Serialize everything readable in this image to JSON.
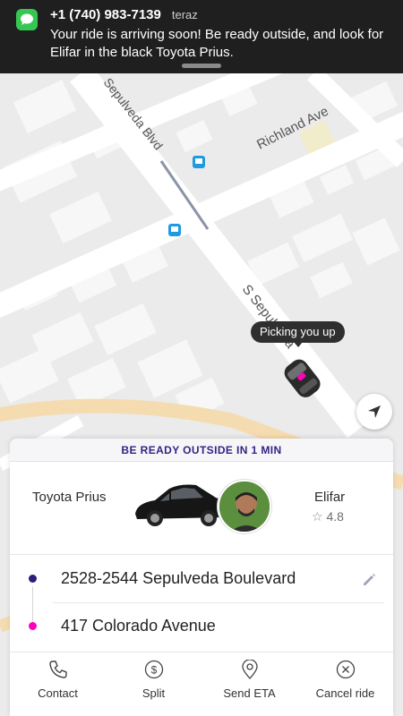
{
  "notification": {
    "sender": "+1 (740) 983-7139",
    "time": "teraz",
    "body": "Your ride is arriving soon! Be ready outside, and look for Elifar in the black Toyota Prius.",
    "icon": "messages-icon"
  },
  "map": {
    "streets": [
      {
        "label": "Sepulveda Blvd"
      },
      {
        "label": "Richland Ave"
      },
      {
        "label": "S Sepulveda"
      }
    ],
    "bubble": "Picking you up",
    "locate_icon": "navigation-arrow-icon"
  },
  "card": {
    "eta_banner": "BE READY OUTSIDE IN 1 MIN",
    "car_model": "Toyota Prius",
    "driver_name": "Elifar",
    "driver_rating": "4.8",
    "pickup": "2528-2544 Sepulveda Boulevard",
    "dropoff": "417 Colorado Avenue",
    "colors": {
      "pickup_dot": "#2d1c7a",
      "dropoff_dot": "#ff00bf",
      "accent": "#352384"
    }
  },
  "actions": [
    {
      "label": "Contact",
      "icon": "phone-icon"
    },
    {
      "label": "Split",
      "icon": "dollar-icon"
    },
    {
      "label": "Send ETA",
      "icon": "location-pin-icon"
    },
    {
      "label": "Cancel ride",
      "icon": "close-circle-icon"
    }
  ]
}
